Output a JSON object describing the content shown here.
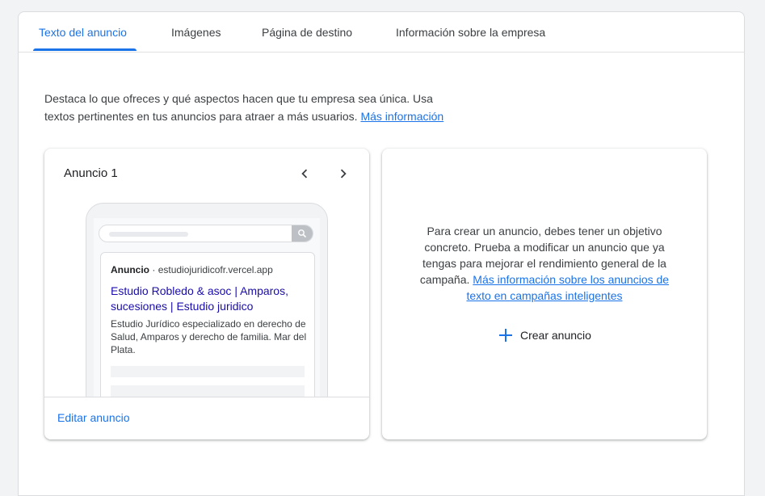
{
  "tabs": [
    {
      "label": "Texto del anuncio",
      "active": true
    },
    {
      "label": "Imágenes",
      "active": false
    },
    {
      "label": "Página de destino",
      "active": false
    },
    {
      "label": "Información sobre la empresa",
      "active": false
    }
  ],
  "intro": {
    "text": "Destaca lo que ofreces y qué aspectos hacen que tu empresa sea única. Usa textos pertinentes en tus anuncios para atraer a más usuarios.",
    "link": "Más información"
  },
  "ad_card": {
    "title": "Anuncio 1",
    "prev_icon": "chevron-left-icon",
    "next_icon": "chevron-right-icon",
    "preview": {
      "search_icon": "search-icon",
      "ad_label": "Anuncio",
      "separator": "·",
      "url": "estudiojuridicofr.vercel.app",
      "headline": "Estudio Robledo & asoc | Amparos, sucesiones | Estudio juridico",
      "description": "Estudio Jurídico especializado en derecho de Salud, Amparos y derecho de familia. Mar del Plata."
    },
    "edit_label": "Editar anuncio"
  },
  "create_card": {
    "text": "Para crear un anuncio, debes tener un objetivo concreto. Prueba a modificar un anuncio que ya tengas para mejorar el rendimiento general de la campaña.",
    "link": "Más información sobre los anuncios de texto en campañas inteligentes",
    "create_label": "Crear anuncio",
    "create_icon": "plus-icon"
  },
  "colors": {
    "accent": "#1a73e8",
    "ad_headline": "#1a0dab",
    "text": "#3c4043",
    "border": "#dadce0"
  }
}
